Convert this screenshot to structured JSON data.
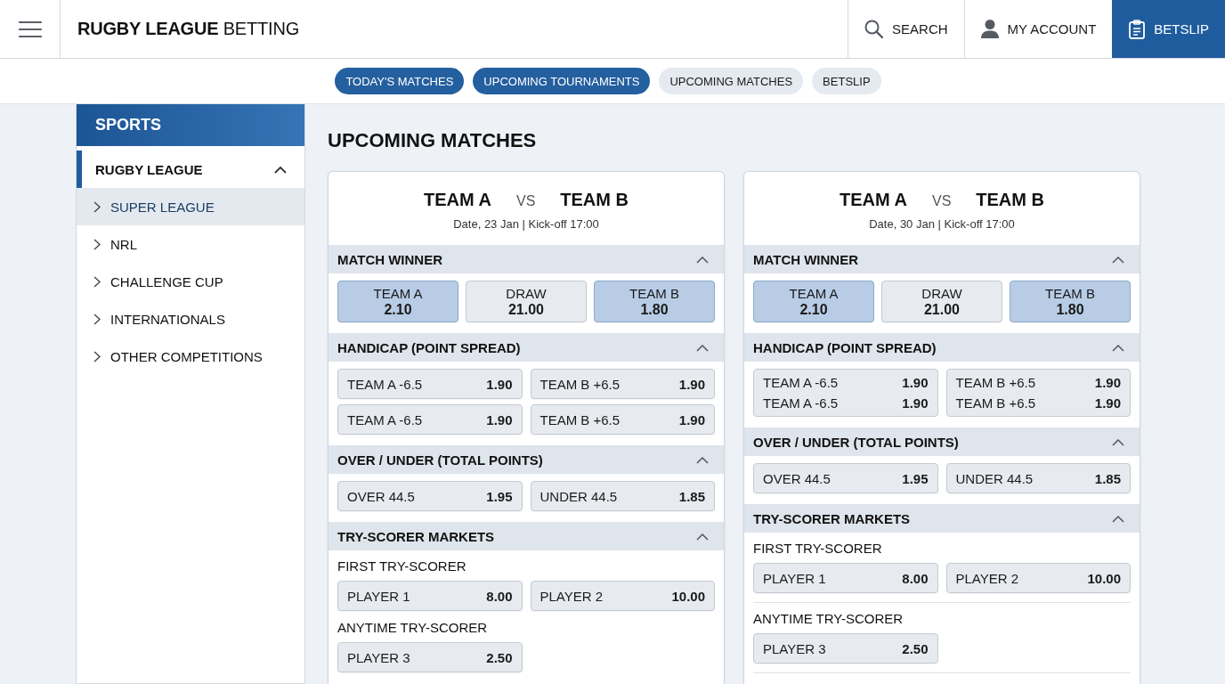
{
  "header": {
    "title": "**RUGBY LEAGUE** BETTING",
    "actions": [
      {
        "kind": "search",
        "label": "SEARCH",
        "selected": false
      },
      {
        "kind": "account",
        "label": "MY ACCOUNT",
        "selected": false
      },
      {
        "kind": "betslip",
        "label": "BETSLIP",
        "selected": true
      }
    ]
  },
  "nav_tabs": [
    {
      "label": "TODAY'S MATCHES",
      "selected": true
    },
    {
      "label": "UPCOMING TOURNAMENTS",
      "selected": true
    },
    {
      "label": "UPCOMING MATCHES",
      "selected": false
    },
    {
      "label": "BETSLIP",
      "selected": false
    }
  ],
  "sidebar": {
    "title": "SPORTS",
    "groups": [
      {
        "label": "RUGBY LEAGUE",
        "expanded": true,
        "children": [
          {
            "label": "SUPER LEAGUE",
            "selected": true,
            "expanded": false
          },
          {
            "label": "NRL",
            "selected": false,
            "expanded": false
          },
          {
            "label": "CHALLENGE CUP",
            "selected": false,
            "expanded": false
          },
          {
            "label": "INTERNATIONALS",
            "selected": false,
            "expanded": false
          },
          {
            "label": "OTHER COMPETITIONS",
            "selected": false,
            "expanded": false
          }
        ]
      }
    ]
  },
  "main": {
    "heading": "UPCOMING MATCHES",
    "matches": [
      {
        "home": "TEAM A",
        "separator": "VS",
        "away": "TEAM B",
        "info": "Date, 23 Jan | Kick-off 17:00",
        "markets": [
          {
            "title": "MATCH WINNER",
            "kind": "three-way",
            "expanded": true,
            "options": [
              {
                "label": "TEAM A",
                "odds": "2.10",
                "selected": true
              },
              {
                "label": "DRAW",
                "odds": "21.00",
                "selected": false
              },
              {
                "label": "TEAM B",
                "odds": "1.80",
                "selected": true
              }
            ]
          },
          {
            "title": "HANDICAP (POINT SPREAD)",
            "kind": "pairs",
            "expanded": true,
            "options": [
              {
                "label": "TEAM A -6.5",
                "odds": "1.90",
                "selected": false
              },
              {
                "label": "TEAM B +6.5",
                "odds": "1.90",
                "selected": false
              },
              {
                "label": "TEAM A -6.5",
                "odds": "1.90",
                "selected": false
              },
              {
                "label": "TEAM B +6.5",
                "odds": "1.90",
                "selected": false
              }
            ]
          },
          {
            "title": "OVER / UNDER (TOTAL POINTS)",
            "kind": "pairs",
            "expanded": true,
            "options": [
              {
                "label": "OVER 44.5",
                "odds": "1.95",
                "selected": false
              },
              {
                "label": "UNDER 44.5",
                "odds": "1.85",
                "selected": false
              }
            ]
          },
          {
            "title": "TRY-SCORER MARKETS",
            "kind": "groups",
            "expanded": true,
            "divided": false,
            "groups": [
              {
                "label": "FIRST TRY-SCORER",
                "options": [
                  {
                    "label": "PLAYER 1",
                    "odds": "8.00",
                    "selected": false
                  },
                  {
                    "label": "PLAYER 2",
                    "odds": "10.00",
                    "selected": false
                  }
                ]
              },
              {
                "label": "ANYTIME TRY-SCORER",
                "options": [
                  {
                    "label": "PLAYER 3",
                    "odds": "2.50",
                    "selected": false
                  }
                ]
              }
            ]
          }
        ]
      },
      {
        "home": "TEAM A",
        "separator": "VS",
        "away": "TEAM B",
        "info": "Date, 30 Jan | Kick-off 17:00",
        "markets": [
          {
            "title": "MATCH WINNER",
            "kind": "three-way",
            "expanded": true,
            "options": [
              {
                "label": "TEAM A",
                "odds": "2.10",
                "selected": true
              },
              {
                "label": "DRAW",
                "odds": "21.00",
                "selected": false
              },
              {
                "label": "TEAM B",
                "odds": "1.80",
                "selected": true
              }
            ]
          },
          {
            "title": "HANDICAP (POINT SPREAD)",
            "kind": "boxes",
            "expanded": true,
            "options": [
              {
                "lines": [
                  {
                    "label": "TEAM A -6.5",
                    "odds": "1.90",
                    "selected": false
                  },
                  {
                    "label": "TEAM A -6.5",
                    "odds": "1.90",
                    "selected": false
                  }
                ]
              },
              {
                "lines": [
                  {
                    "label": "TEAM B +6.5",
                    "odds": "1.90",
                    "selected": false
                  },
                  {
                    "label": "TEAM B +6.5",
                    "odds": "1.90",
                    "selected": false
                  }
                ]
              }
            ]
          },
          {
            "title": "OVER / UNDER (TOTAL POINTS)",
            "kind": "pairs",
            "expanded": true,
            "options": [
              {
                "label": "OVER 44.5",
                "odds": "1.95",
                "selected": false
              },
              {
                "label": "UNDER 44.5",
                "odds": "1.85",
                "selected": false
              }
            ]
          },
          {
            "title": "TRY-SCORER MARKETS",
            "kind": "groups",
            "expanded": true,
            "divided": true,
            "groups": [
              {
                "label": "FIRST TRY-SCORER",
                "options": [
                  {
                    "label": "PLAYER 1",
                    "odds": "8.00",
                    "selected": false
                  },
                  {
                    "label": "PLAYER 2",
                    "odds": "10.00",
                    "selected": false
                  }
                ]
              },
              {
                "label": "ANYTIME TRY-SCORER",
                "options": [
                  {
                    "label": "PLAYER 3",
                    "odds": "2.50",
                    "selected": false
                  }
                ]
              }
            ]
          }
        ]
      }
    ]
  }
}
